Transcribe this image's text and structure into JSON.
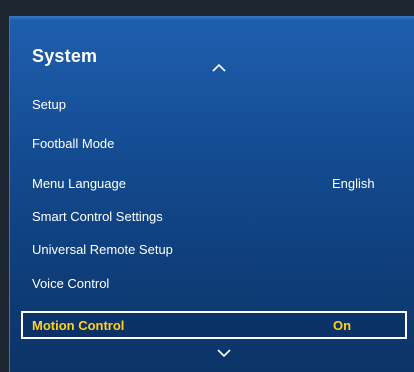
{
  "menu": {
    "title": "System",
    "scroll_up_icon": "chevron-up-icon",
    "scroll_down_icon": "chevron-down-icon",
    "items": [
      {
        "label": "Setup",
        "value": ""
      },
      {
        "label": "Football Mode",
        "value": ""
      },
      {
        "label": "Menu Language",
        "value": "English"
      },
      {
        "label": "Smart Control Settings",
        "value": ""
      },
      {
        "label": "Universal Remote Setup",
        "value": ""
      },
      {
        "label": "Voice Control",
        "value": ""
      },
      {
        "label": "Motion Control",
        "value": "On"
      }
    ],
    "selected_index": 6
  },
  "colors": {
    "highlight_text": "#ffd21a",
    "panel_blue": "#1a56a2",
    "focus_border": "#ffffff"
  }
}
